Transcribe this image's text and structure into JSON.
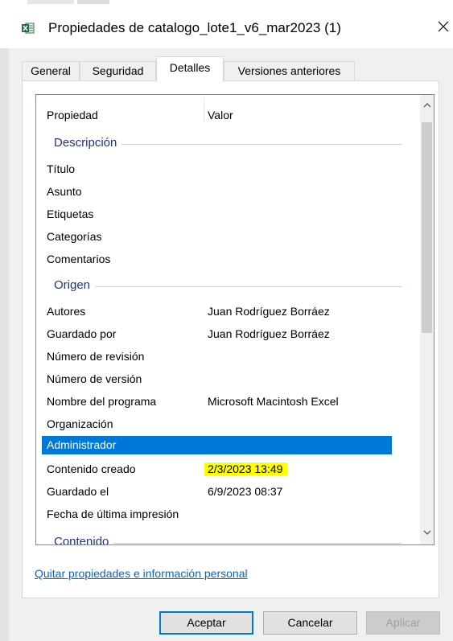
{
  "window": {
    "title": "Propiedades de catalogo_lote1_v6_mar2023 (1)",
    "app_icon": "excel-file-icon",
    "close_icon": "close-icon"
  },
  "tabs": [
    {
      "label": "General",
      "active": false
    },
    {
      "label": "Seguridad",
      "active": false
    },
    {
      "label": "Detalles",
      "active": true
    },
    {
      "label": "Versiones anteriores",
      "active": false
    }
  ],
  "details": {
    "columns": {
      "property": "Propiedad",
      "value": "Valor"
    },
    "groups": {
      "description": "Descripción",
      "origin": "Origen",
      "content": "Contenido"
    },
    "description_rows": [
      {
        "property": "Título",
        "value": ""
      },
      {
        "property": "Asunto",
        "value": ""
      },
      {
        "property": "Etiquetas",
        "value": ""
      },
      {
        "property": "Categorías",
        "value": ""
      },
      {
        "property": "Comentarios",
        "value": ""
      }
    ],
    "origin_rows": [
      {
        "property": "Autores",
        "value": "Juan Rodríguez Borráez"
      },
      {
        "property": "Guardado por",
        "value": "Juan Rodríguez Borráez"
      },
      {
        "property": "Número de revisión",
        "value": ""
      },
      {
        "property": "Número de versión",
        "value": ""
      },
      {
        "property": "Nombre del programa",
        "value": "Microsoft Macintosh Excel"
      },
      {
        "property": "Organización",
        "value": ""
      },
      {
        "property": "Administrador",
        "value": "",
        "selected": true
      },
      {
        "property": "Contenido creado",
        "value": "2/3/2023 13:49",
        "highlighted": true
      },
      {
        "property": "Guardado el",
        "value": "6/9/2023 08:37"
      },
      {
        "property": "Fecha de última impresión",
        "value": ""
      }
    ]
  },
  "link": {
    "label": "Quitar propiedades e información personal"
  },
  "buttons": {
    "ok": "Aceptar",
    "cancel": "Cancelar",
    "apply": "Aplicar"
  },
  "colors": {
    "selection": "#0078d7",
    "highlight": "#ffff00",
    "group_text": "#1e3287",
    "link": "#0066cc"
  }
}
